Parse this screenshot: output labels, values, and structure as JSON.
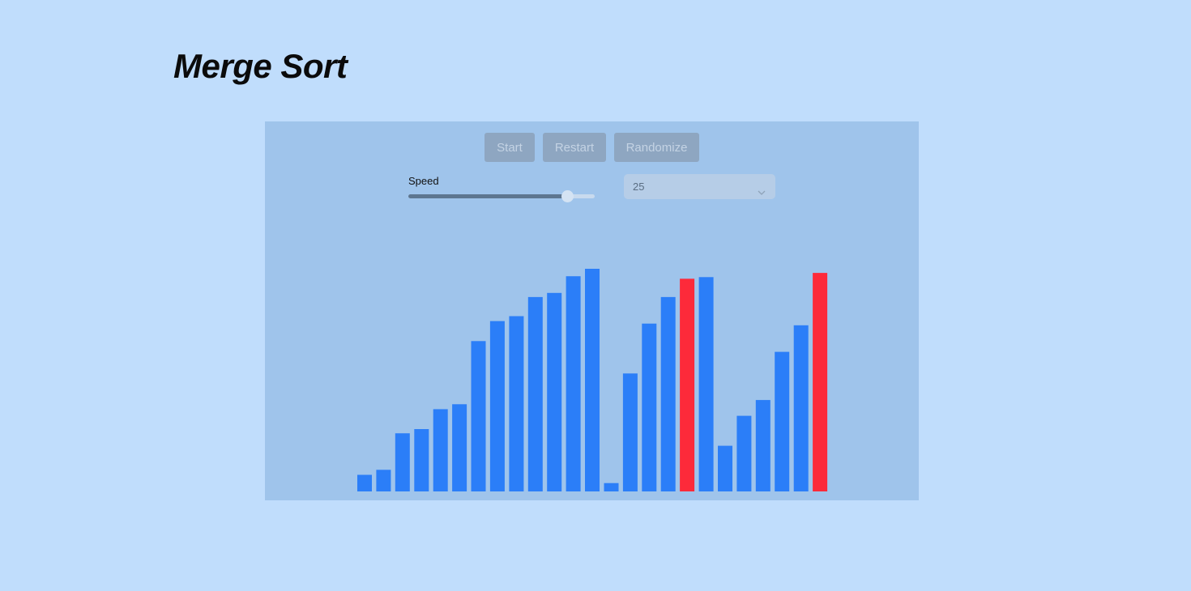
{
  "title": "Merge Sort",
  "controls": {
    "start_label": "Start",
    "restart_label": "Restart",
    "randomize_label": "Randomize",
    "speed_label": "Speed",
    "speed_value": 0.85,
    "size_value": "25",
    "size_icon": "chevron-down-icon"
  },
  "colors": {
    "background": "#c0ddfc",
    "panel": "#9fc4eb",
    "bar_default": "#2b7ef8",
    "bar_active": "#fd2a3a",
    "button": "#8ea6c1"
  },
  "chart_data": {
    "type": "bar",
    "values": [
      20,
      26,
      70,
      75,
      99,
      105,
      181,
      205,
      211,
      234,
      239,
      259,
      268,
      10,
      142,
      202,
      234,
      256,
      258,
      55,
      91,
      110,
      168,
      200,
      263
    ],
    "active_indices": [
      17,
      24
    ],
    "ylim": [
      0,
      268
    ]
  }
}
